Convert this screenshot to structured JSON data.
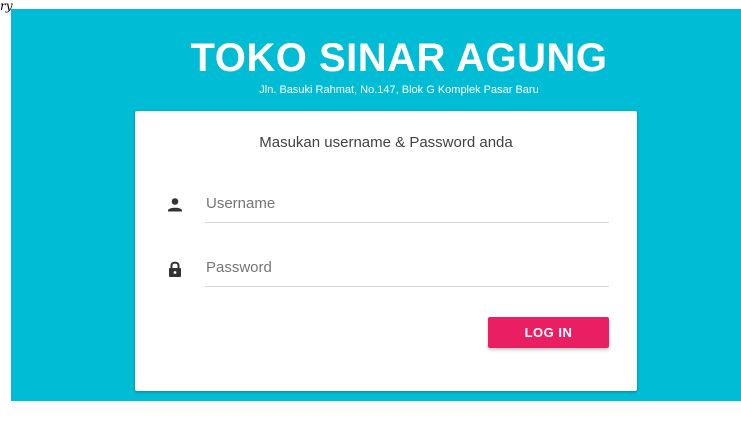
{
  "corner_mark": "ry",
  "header": {
    "title": "TOKO SINAR AGUNG",
    "address": "Jln. Basuki Rahmat, No.147, Blok G Komplek Pasar Baru"
  },
  "login": {
    "heading": "Masukan username & Password anda",
    "username": {
      "placeholder": "Username",
      "value": "",
      "icon": "person-icon"
    },
    "password": {
      "placeholder": "Password",
      "value": "",
      "icon": "lock-icon"
    },
    "submit_label": "LOG IN"
  },
  "colors": {
    "background": "#00bcd4",
    "card": "#ffffff",
    "button": "#e91e63",
    "icon": "#333333"
  }
}
